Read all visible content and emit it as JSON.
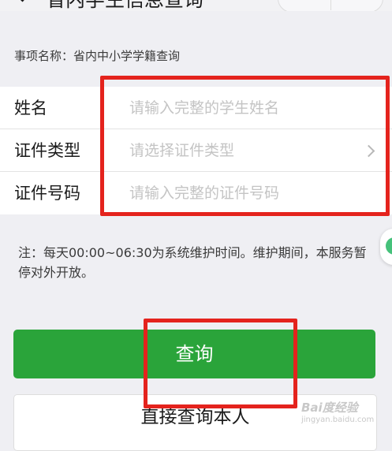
{
  "nav": {
    "title": "省内学生信息查询"
  },
  "item": {
    "name": "事项名称：省内中小学学籍查询"
  },
  "form": {
    "rows": [
      {
        "label": "姓名",
        "placeholder": "请输入完整的学生姓名"
      },
      {
        "label": "证件类型",
        "placeholder": "请选择证件类型"
      },
      {
        "label": "证件号码",
        "placeholder": "请输入完整的证件号码"
      }
    ]
  },
  "note": "注：每天00:00~06:30为系统维护时间。维护期间，本服务暂停对外开放。",
  "buttons": {
    "query": "查询",
    "query_self": "直接查询本人"
  },
  "colors": {
    "primary": "#2aa43a",
    "annotation": "#e4231d"
  },
  "icons": {
    "back": "back-arrow-icon",
    "more": "more-icon",
    "close": "close-icon",
    "select": "chevron-right-icon",
    "assistant": "chat-icon"
  },
  "watermark": {
    "logo": "Bai度经验",
    "url": "jingyan.baidu.com"
  }
}
